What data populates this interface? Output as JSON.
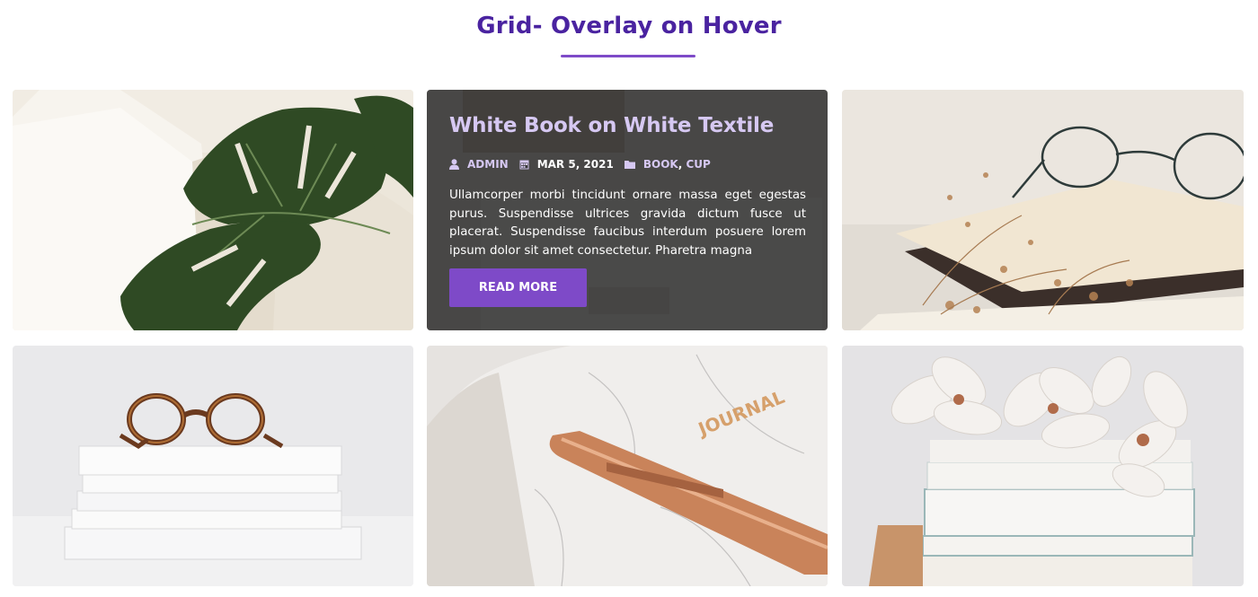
{
  "section": {
    "title": "Grid- Overlay on Hover"
  },
  "cards": [
    {
      "image": "white book with monstera leaf"
    },
    {
      "image": "white book on white textile",
      "overlay": {
        "title": "White Book on White Textile",
        "author": "ADMIN",
        "date": "MAR 5, 2021",
        "categories": [
          "BOOK",
          "CUP"
        ],
        "category_separator": ", ",
        "excerpt": "Ullamcorper morbi tincidunt ornare massa eget egestas purus. Suspendisse ultrices gravida dictum fusce ut placerat. Suspendisse faucibus interdum posuere lorem ipsum dolor sit amet consectetur. Pharetra magna",
        "button_label": "READ MORE"
      }
    },
    {
      "image": "glasses on books with dried flowers"
    },
    {
      "image": "glasses on stack of books"
    },
    {
      "image": "journal with rose gold pen"
    },
    {
      "image": "magnolia flowers on stacked books"
    }
  ],
  "colors": {
    "accent": "#7e4ac8",
    "heading": "#4a23a0",
    "overlay_text": "#d6c8f2"
  },
  "icons": [
    "user-icon",
    "calendar-icon",
    "folder-icon"
  ]
}
